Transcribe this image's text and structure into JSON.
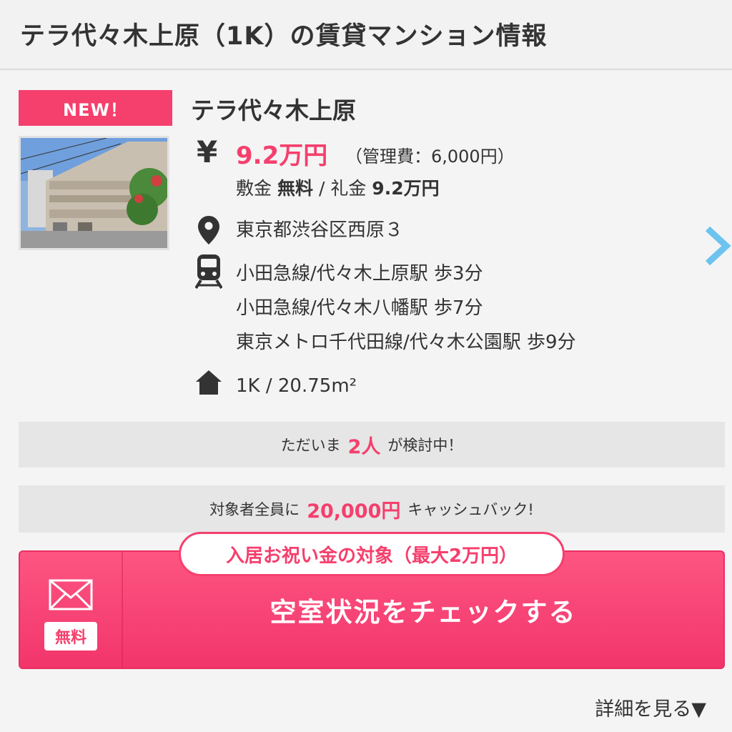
{
  "header": {
    "title": "テラ代々木上原（1K）の賃貸マンション情報"
  },
  "listing": {
    "badge": "NEW！",
    "name": "テラ代々木上原",
    "yen_icon": "¥",
    "rent": "9.2万円",
    "management_fee": "（管理費：6,000円）",
    "deposit_label": "敷金",
    "deposit_value": "無料",
    "separator": "/",
    "key_money_label": "礼金",
    "key_money_value": "9.2万円",
    "address": "東京都渋谷区西原３",
    "stations": [
      "小田急線/代々木上原駅 歩3分",
      "小田急線/代々木八幡駅 歩7分",
      "東京メトロ千代田線/代々木公園駅 歩9分"
    ],
    "layout_area": "1K / 20.75m²"
  },
  "viewers_bar": {
    "prefix": "ただいま",
    "count": "2人",
    "suffix": "が検討中！"
  },
  "cashback_bar": {
    "prefix": "対象者全員に",
    "amount": "20,000円",
    "suffix": "キャッシュバック!"
  },
  "cta": {
    "gift_label": "入居お祝い金の対象（最大2万円）",
    "free_label": "無料",
    "button_label": "空室状況をチェックする"
  },
  "details_link": "詳細を見る▼",
  "colors": {
    "accent": "#f53f6d",
    "chevron": "#6cc3ef"
  },
  "icons": [
    "yen-icon",
    "map-pin-icon",
    "train-icon",
    "home-icon",
    "chevron-right-icon",
    "mail-icon"
  ]
}
